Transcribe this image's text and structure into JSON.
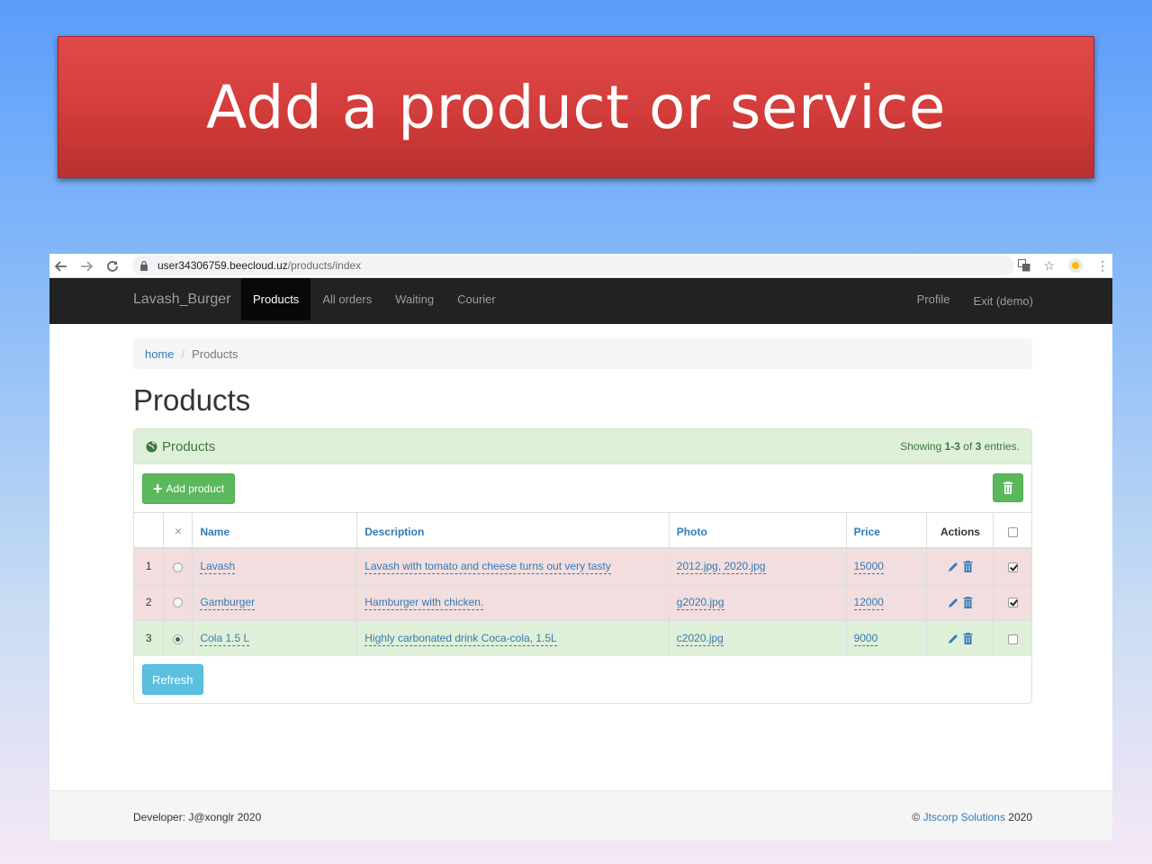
{
  "slide": {
    "title": "Add a product or service"
  },
  "browser": {
    "url_host": "user34306759.beecloud.uz",
    "url_path": "/products/index"
  },
  "navbar": {
    "brand": "Lavash_Burger",
    "items": [
      {
        "label": "Products",
        "active": true
      },
      {
        "label": "All orders",
        "active": false
      },
      {
        "label": "Waiting",
        "active": false
      },
      {
        "label": "Courier",
        "active": false
      }
    ],
    "right": [
      {
        "label": "Profile"
      },
      {
        "label": "Exit (demo)"
      }
    ]
  },
  "breadcrumb": {
    "home": "home",
    "separator": "/",
    "current": "Products"
  },
  "page_title": "Products",
  "panel": {
    "title": "Products",
    "summary_prefix": "Showing ",
    "summary_range": "1-3",
    "summary_of": " of ",
    "summary_total": "3",
    "summary_suffix": " entries.",
    "add_button": "Add product",
    "refresh_button": "Refresh"
  },
  "table": {
    "headers": {
      "x": "×",
      "name": "Name",
      "description": "Description",
      "photo": "Photo",
      "price": "Price",
      "actions": "Actions"
    },
    "rows": [
      {
        "num": "1",
        "name": "Lavash",
        "description": "Lavash with tomato and cheese turns out very tasty",
        "photo": "2012.jpg, 2020.jpg",
        "price": "15000",
        "selected": false,
        "checked": true,
        "status": "danger"
      },
      {
        "num": "2",
        "name": "Gamburger",
        "description": "Hamburger with chicken.",
        "photo": "g2020.jpg",
        "price": "12000",
        "selected": false,
        "checked": true,
        "status": "danger"
      },
      {
        "num": "3",
        "name": "Cola 1.5 L",
        "description": "Highly carbonated drink Coca-cola, 1.5L",
        "photo": "c2020.jpg",
        "price": "9000",
        "selected": true,
        "checked": false,
        "status": "success"
      }
    ]
  },
  "footer": {
    "left": "Developer: J@xonglr 2020",
    "right_prefix": "© ",
    "right_link": "Jtscorp Solutions",
    "right_suffix": " 2020"
  },
  "colors": {
    "banner": "#d84140",
    "navbar": "#222222",
    "success": "#5cb85c",
    "info": "#5bc0de",
    "link": "#337ab7"
  }
}
